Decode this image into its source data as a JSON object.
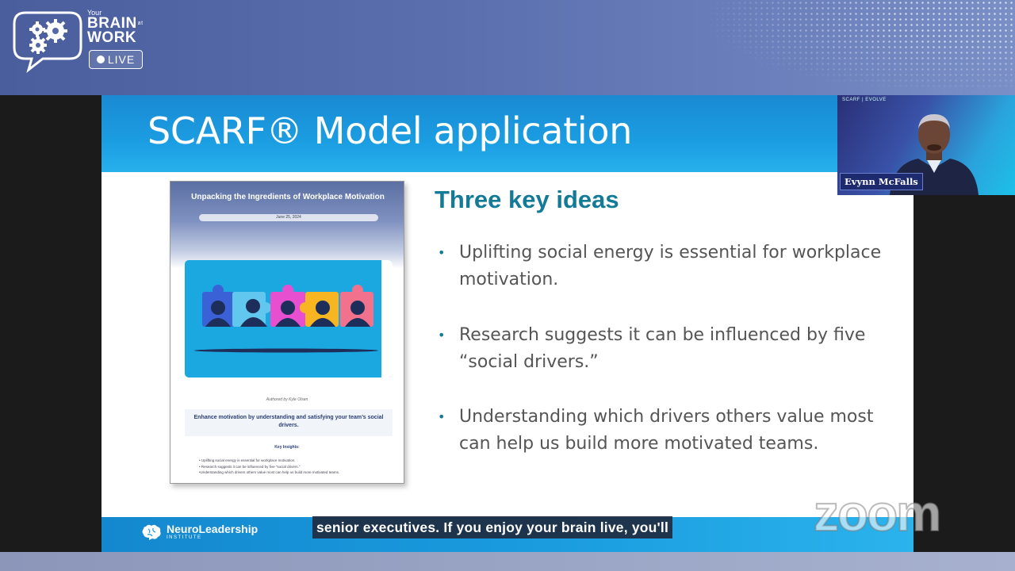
{
  "show_logo": {
    "your": "Your",
    "brain": "BRAIN",
    "at": "at",
    "work": "WORK",
    "live": "LIVE"
  },
  "slide": {
    "title": "SCARF® Model application",
    "heading": "Three key ideas",
    "ideas": [
      "Uplifting social energy is essential for workplace motivation.",
      "Research suggests it can be influenced by five “social drivers.”",
      "Understanding which drivers others value most can help us build more motivated teams."
    ],
    "document": {
      "title": "Unpacking the Ingredients of Workplace Motivation",
      "date": "June 25, 2024",
      "author": "Authored by Kyle Olsen",
      "summary": "Enhance motivation by understanding and satisfying your team’s social drivers.",
      "insights_title": "Key Insights:",
      "insights": [
        "• Uplifting social energy is essential for workplace motivation.",
        "• Research suggests it can be influenced by five “social drivers.”",
        "•Understanding which drivers others value most can help us build more motivated teams."
      ]
    },
    "footer": {
      "org_name": "NeuroLeadership",
      "org_sub": "INSTITUTE"
    }
  },
  "caption": "senior executives. If you enjoy your brain live, you'll",
  "zoom_watermark": "zoom",
  "video_tile": {
    "brand": "SCARF | EVOLVE",
    "participant_name": "Evynn McFalls"
  },
  "colors": {
    "slide_blue": "#1b9de2",
    "heading_teal": "#137a98",
    "banner_blue": "#5b6fae",
    "puzzle": [
      "#3a62d6",
      "#62c7ef",
      "#e64fd0",
      "#f6b521",
      "#f2728e"
    ]
  }
}
